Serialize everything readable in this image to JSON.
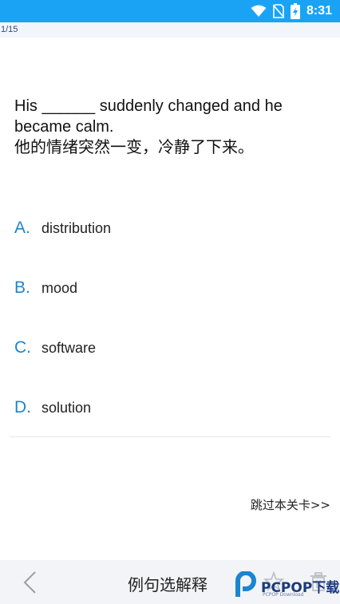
{
  "status_bar": {
    "time": "8:31",
    "icons": [
      "wifi-icon",
      "no-sim-icon",
      "battery-charging-icon"
    ]
  },
  "progress": {
    "text": "1/15"
  },
  "question": {
    "en": "His ______ suddenly changed and he became calm.",
    "cn": "他的情绪突然一变，冷静了下来。"
  },
  "options": [
    {
      "letter": "A.",
      "text": "distribution"
    },
    {
      "letter": "B.",
      "text": "mood"
    },
    {
      "letter": "C.",
      "text": "software"
    },
    {
      "letter": "D.",
      "text": "solution"
    }
  ],
  "skip_label": "跳过本关卡>>",
  "bottom_bar": {
    "title": "例句选解释",
    "icons": [
      "back-icon",
      "star-icon",
      "trash-icon"
    ]
  },
  "watermark": {
    "text": "PCPOP下载",
    "subtext": "PCPOP Download"
  },
  "colors": {
    "status_bar": "#1aa3f5",
    "accent": "#1a86d0",
    "bottom_bar": "#f2f4f7"
  }
}
